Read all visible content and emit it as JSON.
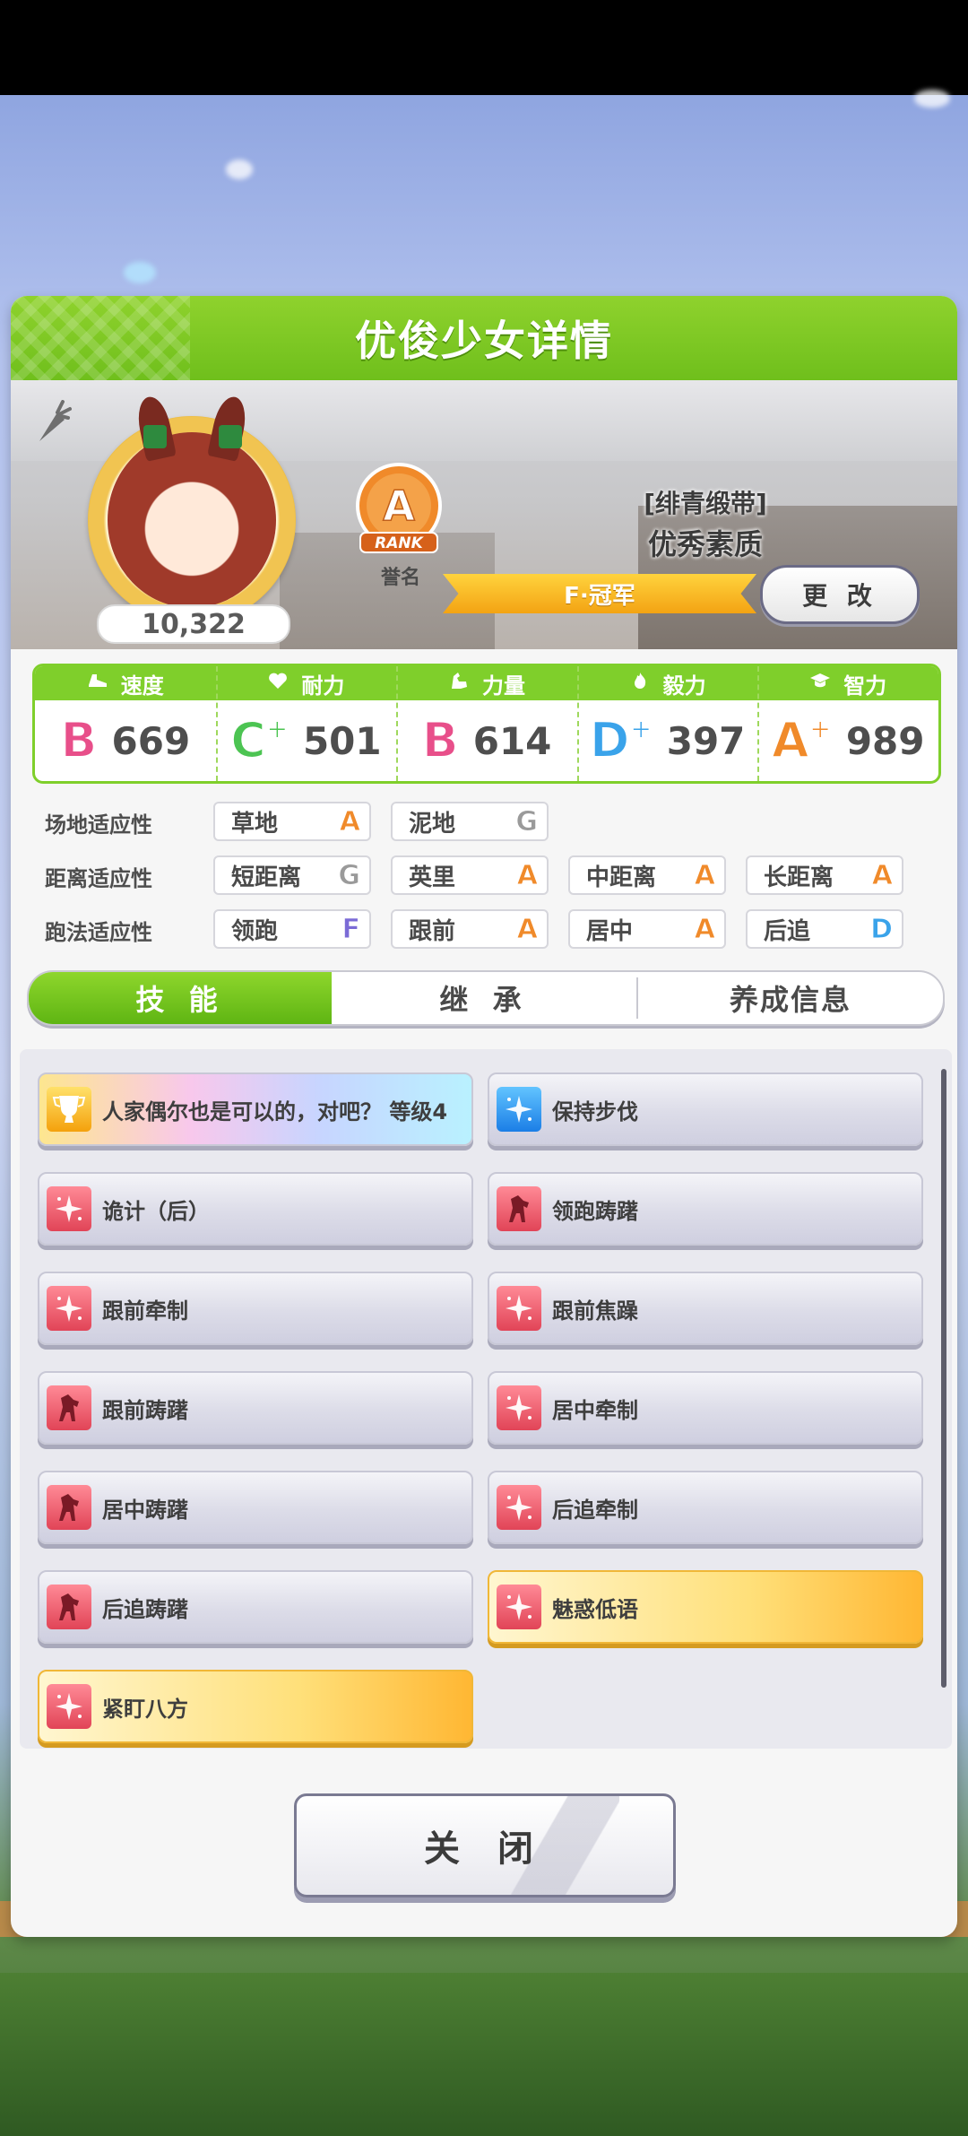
{
  "header": {
    "title": "优俊少女详情"
  },
  "profile": {
    "fan_count": "10,322",
    "rank_letter": "A",
    "rank_word": "RANK",
    "rank_caption": "誉名",
    "epithet_line1": "[绯青缎带]",
    "epithet_line2": "优秀素质",
    "title_ribbon": "F·冠军",
    "change_label": "更 改"
  },
  "stats": [
    {
      "label": "速度",
      "grade": "B",
      "plus": "",
      "value": "669",
      "color": "#e84f8a",
      "icon": "shoe-icon"
    },
    {
      "label": "耐力",
      "grade": "C",
      "plus": "+",
      "value": "501",
      "color": "#4cc452",
      "icon": "heart-icon"
    },
    {
      "label": "力量",
      "grade": "B",
      "plus": "",
      "value": "614",
      "color": "#e84f8a",
      "icon": "muscle-icon"
    },
    {
      "label": "毅力",
      "grade": "D",
      "plus": "+",
      "value": "397",
      "color": "#3aa3ea",
      "icon": "flame-icon"
    },
    {
      "label": "智力",
      "grade": "A",
      "plus": "+",
      "value": "989",
      "color": "#f08a2a",
      "icon": "graduation-cap-icon"
    }
  ],
  "aptitude": {
    "track_label": "场地适应性",
    "distance_label": "距离适应性",
    "style_label": "跑法适应性",
    "track": [
      {
        "name": "草地",
        "grade": "A"
      },
      {
        "name": "泥地",
        "grade": "G"
      }
    ],
    "distance": [
      {
        "name": "短距离",
        "grade": "G"
      },
      {
        "name": "英里",
        "grade": "A"
      },
      {
        "name": "中距离",
        "grade": "A"
      },
      {
        "name": "长距离",
        "grade": "A"
      }
    ],
    "style": [
      {
        "name": "领跑",
        "grade": "F"
      },
      {
        "name": "跟前",
        "grade": "A"
      },
      {
        "name": "居中",
        "grade": "A"
      },
      {
        "name": "后追",
        "grade": "D"
      }
    ],
    "grade_colors": {
      "A": "#f08a2a",
      "G": "#9a9a9a",
      "F": "#7b6bd6",
      "D": "#3aa3ea"
    }
  },
  "tabs": [
    {
      "label": "技 能",
      "active": true
    },
    {
      "label": "继 承",
      "active": false
    },
    {
      "label": "养成信息",
      "active": false
    }
  ],
  "skills": [
    {
      "name": "人家偶尔也是可以的，对吧？ 等级4",
      "style": "rainbow",
      "icon": "trophy-icon",
      "icon_color": "gold"
    },
    {
      "name": "保持步伐",
      "style": "normal",
      "icon": "sparkle-icon",
      "icon_color": "blue"
    },
    {
      "name": "诡计（后）",
      "style": "normal",
      "icon": "sparkle-icon",
      "icon_color": "red"
    },
    {
      "name": "领跑踌躇",
      "style": "normal",
      "icon": "horse-icon",
      "icon_color": "red"
    },
    {
      "name": "跟前牵制",
      "style": "normal",
      "icon": "sparkle-icon",
      "icon_color": "red"
    },
    {
      "name": "跟前焦躁",
      "style": "normal",
      "icon": "sparkle-icon",
      "icon_color": "red"
    },
    {
      "name": "跟前踌躇",
      "style": "normal",
      "icon": "horse-icon",
      "icon_color": "red"
    },
    {
      "name": "居中牵制",
      "style": "normal",
      "icon": "sparkle-icon",
      "icon_color": "red"
    },
    {
      "name": "居中踌躇",
      "style": "normal",
      "icon": "horse-icon",
      "icon_color": "red"
    },
    {
      "name": "后追牵制",
      "style": "normal",
      "icon": "sparkle-icon",
      "icon_color": "red"
    },
    {
      "name": "后追踌躇",
      "style": "normal",
      "icon": "horse-icon",
      "icon_color": "red"
    },
    {
      "name": "魅惑低语",
      "style": "gold",
      "icon": "sparkle-icon",
      "icon_color": "red"
    },
    {
      "name": "紧盯八方",
      "style": "gold",
      "icon": "sparkle-icon",
      "icon_color": "red"
    }
  ],
  "close_label": "关 闭"
}
